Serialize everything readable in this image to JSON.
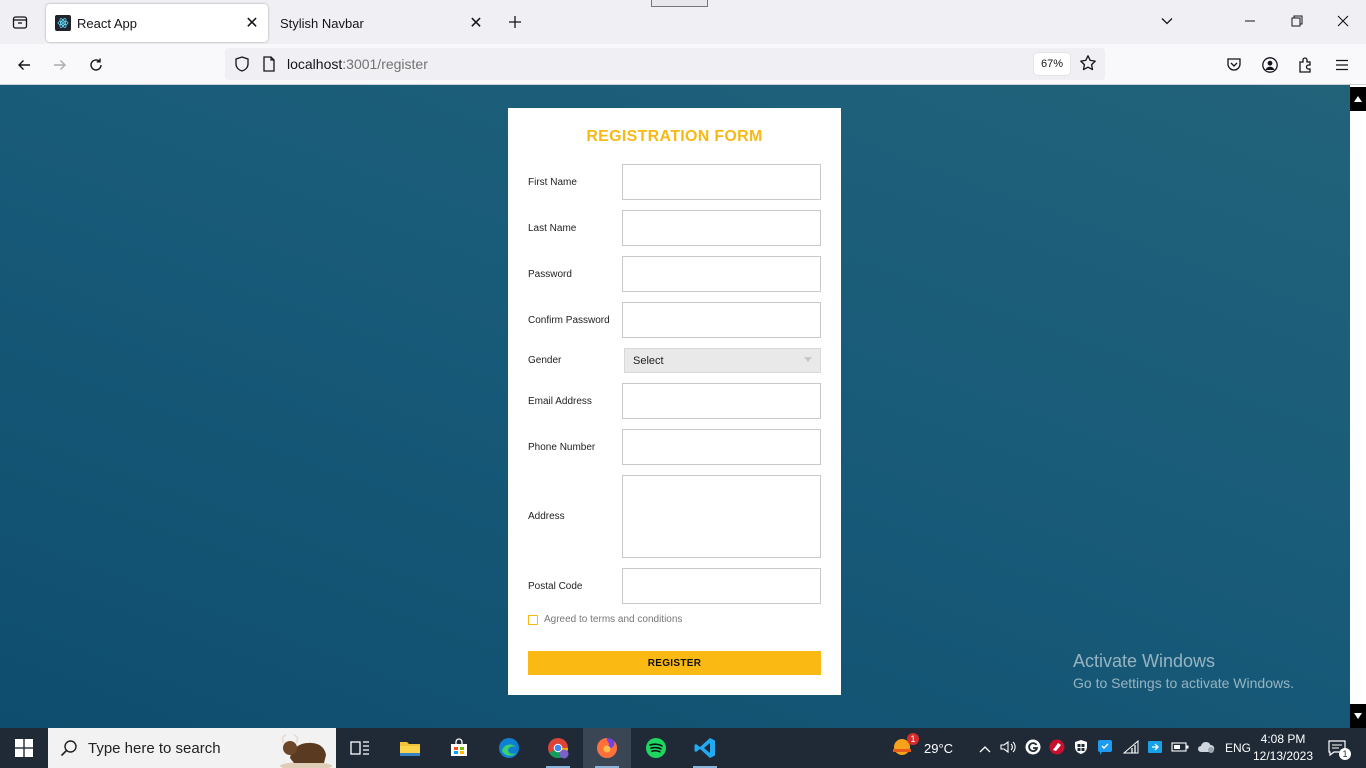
{
  "browser": {
    "tabs": [
      {
        "title": "React App",
        "active": true
      },
      {
        "title": "Stylish Navbar",
        "active": false
      }
    ],
    "url": {
      "host": "localhost",
      "rest": ":3001/register"
    },
    "zoom": "67%"
  },
  "form": {
    "title": "REGISTRATION FORM",
    "fields": {
      "first_name": "First Name",
      "last_name": "Last Name",
      "password": "Password",
      "confirm_password": "Confirm Password",
      "gender": "Gender",
      "email": "Email Address",
      "phone": "Phone Number",
      "address": "Address",
      "postal_code": "Postal Code"
    },
    "gender_selected": "Select",
    "terms_label": "Agreed to terms and conditions",
    "register_label": "REGISTER"
  },
  "watermark": {
    "line1": "Activate Windows",
    "line2": "Go to Settings to activate Windows."
  },
  "taskbar": {
    "search_placeholder": "Type here to search",
    "weather_temp": "29°C",
    "weather_badge": "1",
    "language": "ENG",
    "time": "4:08 PM",
    "date": "12/13/2023",
    "notification_count": "1"
  },
  "colors": {
    "accent": "#f6b915",
    "content_bg": "#185b79",
    "taskbar": "#1f2a36"
  }
}
